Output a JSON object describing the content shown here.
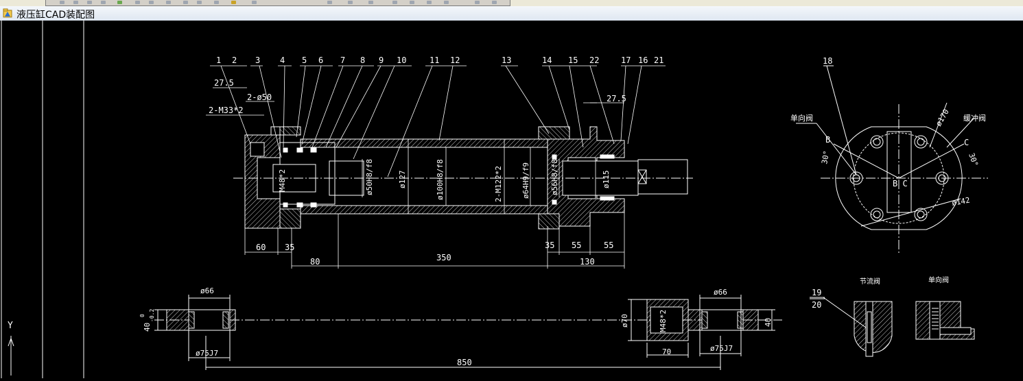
{
  "window": {
    "title": "液压缸CAD装配图",
    "icon": "autocad-icon"
  },
  "ucs": {
    "y_label": "Y"
  },
  "balloons": [
    "1",
    "2",
    "3",
    "4",
    "5",
    "6",
    "7",
    "8",
    "9",
    "10",
    "11",
    "12",
    "13",
    "14",
    "15",
    "22",
    "17",
    "16",
    "21"
  ],
  "balloon_18": "18",
  "dims": {
    "d27_5_left": "27.5",
    "d2_phi50": "2-ø50",
    "d2_m33": "2-M33*2",
    "d27_5_right": "27.5",
    "d60": "60",
    "d35_left": "35",
    "d80": "80",
    "d350": "350",
    "d35_right": "35",
    "d55_a": "55",
    "d55_b": "55",
    "d130": "130",
    "m48": "M48*2",
    "phi50": "ø50H8/f8",
    "phi127": "ø127",
    "phi100": "ø100H8/f8",
    "m122": "2-M122*2",
    "phi64": "ø64H9/f9",
    "phi56": "ø56H8/f8",
    "phi115": "ø115"
  },
  "endview": {
    "label_b": "B",
    "label_c": "C",
    "label_bc": "B C",
    "check_valve": "单向阀",
    "buffer_valve": "缓冲阀",
    "phi170": "ø170",
    "phi142": "ø142",
    "angle_left": "30°",
    "angle_right": "30°"
  },
  "rod": {
    "phi66_left": "ø66",
    "phi75_left": "ø75J7",
    "d40_left": "40",
    "tol_upper": "0",
    "tol_lower": "-0.2",
    "d850": "850",
    "phi70": "ø70",
    "m48": "M48*2",
    "d70": "70",
    "phi66_right": "ø66",
    "phi75_right": "ø75J7",
    "d40_right": "40"
  },
  "details": {
    "n19": "19",
    "n20": "20",
    "throttle": "节流阀",
    "check": "单向阀"
  }
}
